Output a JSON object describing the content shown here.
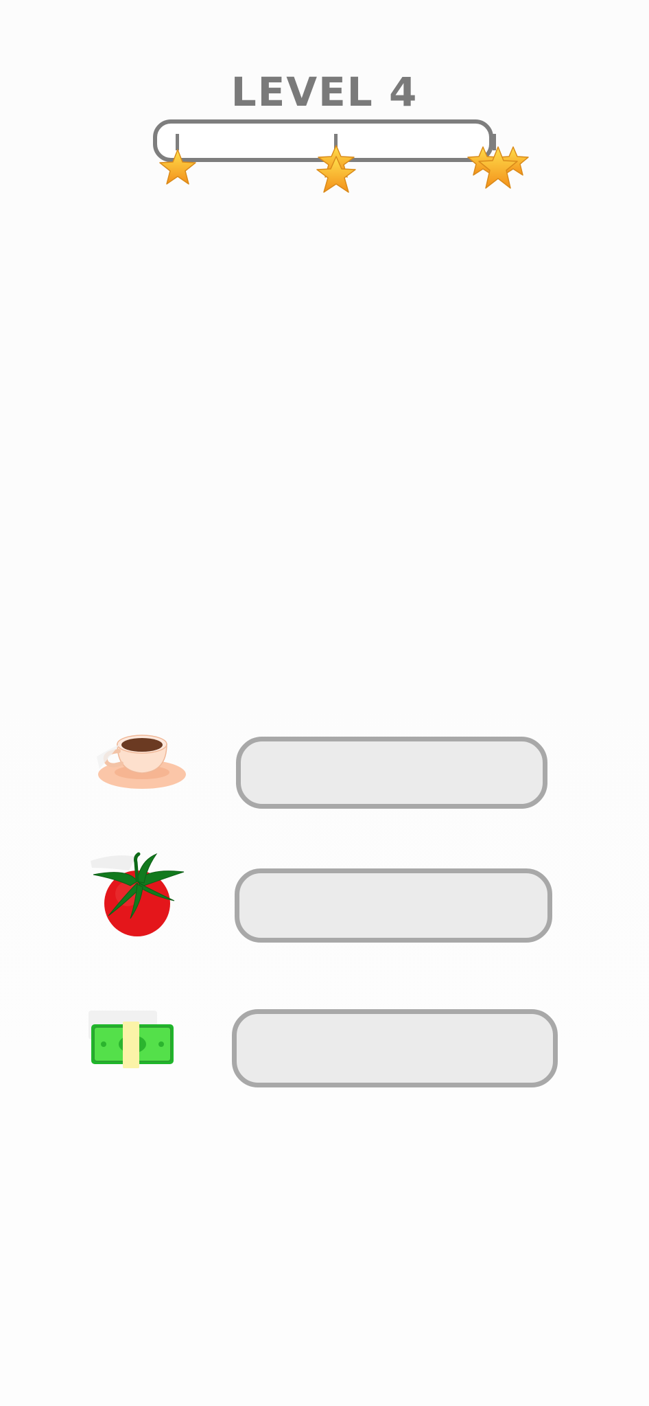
{
  "level": {
    "title": "LEVEL 4",
    "progress_fraction": 0
  },
  "milestones": [
    {
      "stars": 1
    },
    {
      "stars": 2
    },
    {
      "stars": 3
    }
  ],
  "rows": [
    {
      "item": "coffee-cup-icon",
      "answer": ""
    },
    {
      "item": "tomato-icon",
      "answer": ""
    },
    {
      "item": "money-bundle-icon",
      "answer": ""
    }
  ],
  "colors": {
    "title": "#7a7a7a",
    "bar_outline": "#7e7e7e",
    "star_fill_top": "#ffd84a",
    "star_fill_bottom": "#f39c12",
    "slot_fill": "#ebebeb",
    "slot_border": "#a8a8a8"
  }
}
